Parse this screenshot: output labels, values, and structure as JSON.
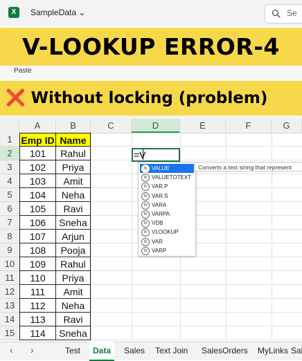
{
  "app": {
    "logo": "X",
    "filename": "SampleData",
    "search_label": "Se"
  },
  "banner": {
    "title": "V-LOOKUP ERROR-4",
    "subtitle": "Without locking (problem)",
    "subtitle_icon": "❌"
  },
  "ribbon": {
    "paste_label": "Paste"
  },
  "columns": [
    "A",
    "B",
    "C",
    "D",
    "E",
    "F",
    "G"
  ],
  "rows": [
    "1",
    "2",
    "3",
    "4",
    "5",
    "6",
    "7",
    "8",
    "9",
    "10",
    "11",
    "12",
    "13",
    "14",
    "15"
  ],
  "table": {
    "header": [
      "Emp ID",
      "Name"
    ],
    "rows": [
      [
        "101",
        "Rahul"
      ],
      [
        "102",
        "Priya"
      ],
      [
        "103",
        "Amit"
      ],
      [
        "104",
        "Neha"
      ],
      [
        "105",
        "Ravi"
      ],
      [
        "106",
        "Sneha"
      ],
      [
        "107",
        "Arjun"
      ],
      [
        "108",
        "Pooja"
      ],
      [
        "109",
        "Rahul"
      ],
      [
        "110",
        "Priya"
      ],
      [
        "111",
        "Amit"
      ],
      [
        "112",
        "Neha"
      ],
      [
        "113",
        "Ravi"
      ],
      [
        "114",
        "Sneha"
      ]
    ]
  },
  "formula": {
    "text": "=V"
  },
  "autocomplete": {
    "items": [
      "VALUE",
      "VALUETOTEXT",
      "VAR.P",
      "VAR.S",
      "VARA",
      "VARPA",
      "VDB",
      "VLOOKUP",
      "VAR",
      "VARP"
    ],
    "selected_index": 0,
    "tooltip": "Converts a text string that represent"
  },
  "sheet_tabs": [
    "Test",
    "Data",
    "Sales",
    "Text Join",
    "SalesOrders",
    "MyLinks",
    "Sales"
  ],
  "active_tab": "Data",
  "colors": {
    "accent": "#107c41",
    "banner": "#f6d84a",
    "header_fill": "#ffff00",
    "selected": "#1a73e8"
  }
}
